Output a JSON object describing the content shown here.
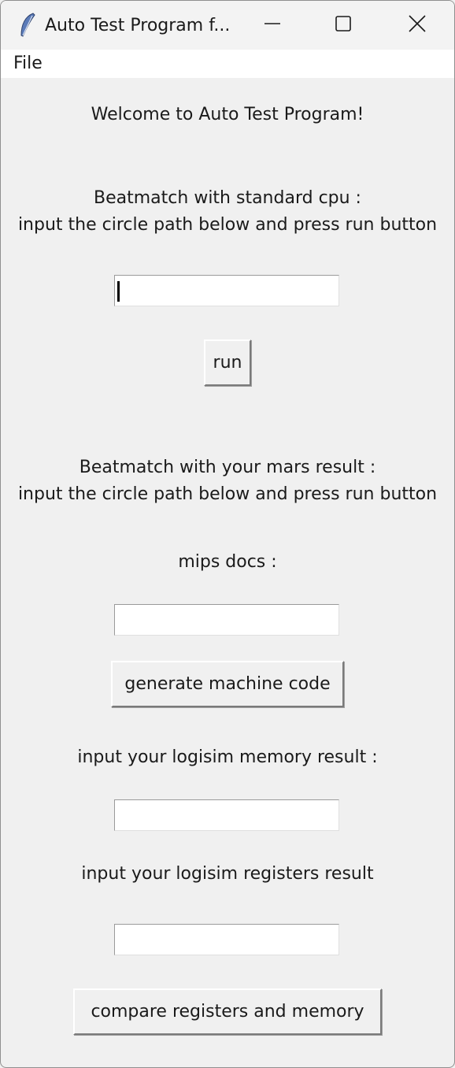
{
  "window": {
    "title": "Auto Test Program f..."
  },
  "menubar": {
    "file_label": "File"
  },
  "main": {
    "welcome": "Welcome to Auto Test Program!",
    "section1_line1": "Beatmatch with standard cpu :",
    "section1_line2": "input the circle path below and press run button",
    "run_label": "run",
    "section2_line1": "Beatmatch with your mars result :",
    "section2_line2": "input the circle path below and press run button",
    "mips_docs_label": "mips docs :",
    "generate_label": "generate machine code",
    "memory_label": "input your logisim memory result :",
    "registers_label": "input your logisim registers result",
    "compare_label": "compare registers and memory",
    "circle_path_value": "",
    "mips_docs_value": "",
    "memory_value": "",
    "registers_value": ""
  }
}
